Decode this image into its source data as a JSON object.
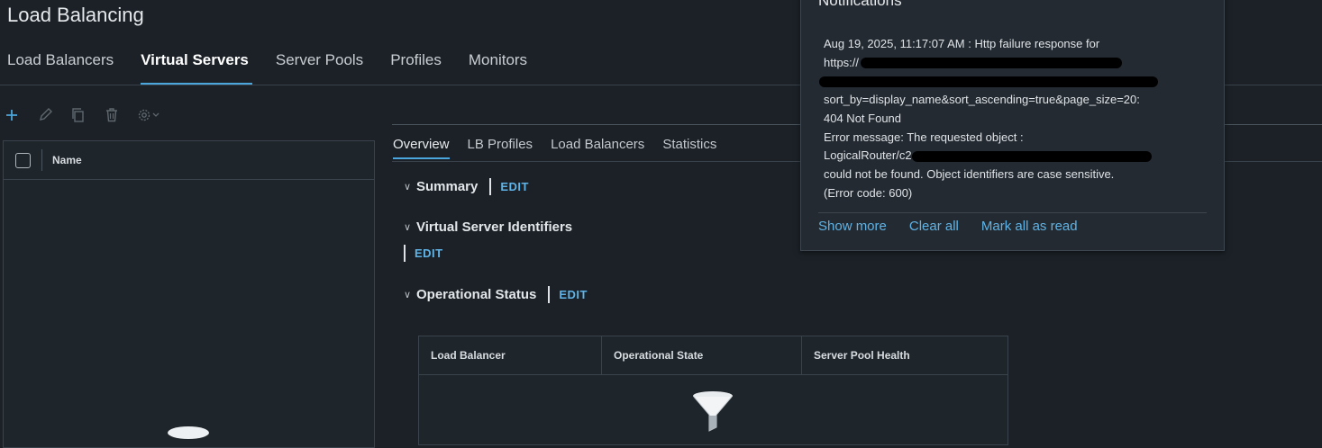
{
  "page": {
    "title": "Load Balancing"
  },
  "tabs": [
    {
      "label": "Load Balancers"
    },
    {
      "label": "Virtual Servers",
      "active": true
    },
    {
      "label": "Server Pools"
    },
    {
      "label": "Profiles"
    },
    {
      "label": "Monitors"
    }
  ],
  "toolbar": {
    "add_icon": "plus-icon",
    "edit_icon": "pencil-icon",
    "clone_icon": "copy-icon",
    "delete_icon": "trash-icon",
    "settings_icon": "gear-icon"
  },
  "list": {
    "column_name": "Name"
  },
  "detail_tabs": [
    {
      "label": "Overview",
      "active": true
    },
    {
      "label": "LB Profiles"
    },
    {
      "label": "Load Balancers"
    },
    {
      "label": "Statistics"
    }
  ],
  "sections": {
    "summary": {
      "title": "Summary",
      "edit": "EDIT"
    },
    "identifiers": {
      "title": "Virtual Server Identifiers",
      "edit": "EDIT"
    },
    "status": {
      "title": "Operational Status",
      "edit": "EDIT"
    }
  },
  "status_table": {
    "columns": [
      "Load Balancer",
      "Operational State",
      "Server Pool Health"
    ],
    "empty_icon": "filter-funnel-icon"
  },
  "notifications": {
    "title": "Notifications",
    "lines": [
      "Aug 19, 2025, 11:17:07 AM : Http failure response for",
      "https://",
      "",
      "sort_by=display_name&sort_ascending=true&page_size=20:",
      "404 Not Found",
      "Error message: The requested object :",
      "LogicalRouter/c2",
      "could not be found. Object identifiers are case sensitive.",
      "(Error code: 600)"
    ],
    "actions": [
      "Show more",
      "Clear all",
      "Mark all as read"
    ]
  },
  "colors": {
    "accent": "#4aa6dd",
    "link": "#5fb3e6",
    "background": "#1b2127"
  }
}
